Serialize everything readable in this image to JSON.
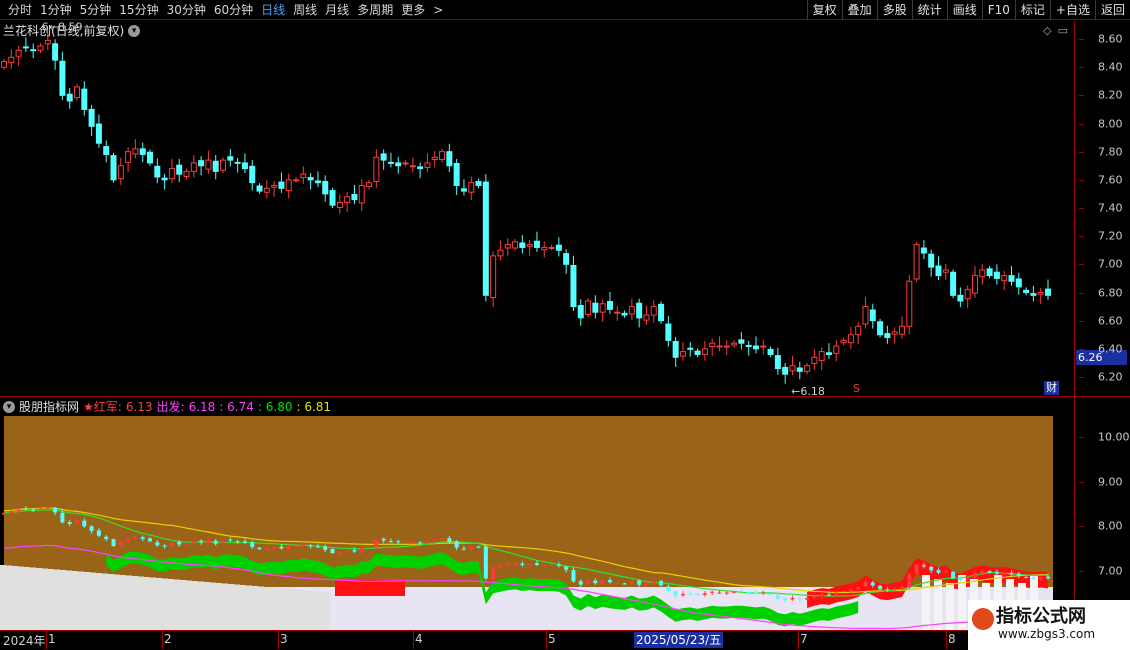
{
  "toolbar": {
    "periods": [
      "分时",
      "1分钟",
      "5分钟",
      "15分钟",
      "30分钟",
      "60分钟",
      "日线",
      "周线",
      "月线",
      "多周期",
      "更多"
    ],
    "active_period": "日线",
    "more_arrow": ">",
    "tools": [
      "复权",
      "叠加",
      "多股",
      "统计",
      "画线",
      "F10",
      "标记",
      "+自选",
      "返回"
    ]
  },
  "main_chart": {
    "title": "兰花科创(日线,前复权)",
    "price_axis": [
      "8.60",
      "8.40",
      "8.20",
      "8.00",
      "7.80",
      "7.60",
      "7.40",
      "7.20",
      "7.00",
      "6.80",
      "6.60",
      "6.40",
      "6.20"
    ],
    "current_price": "6.26",
    "high_marker": "8.59",
    "low_marker": "6.18",
    "s_marker": "S",
    "finance_badge": "财"
  },
  "indicator": {
    "name": "股朋指标网",
    "label_red": "★红军:",
    "value_red": "6.13",
    "label_start": "出发:",
    "values_rest": [
      "6.18",
      ": 6.74",
      ": 6.80",
      ": 6.81"
    ],
    "axis": [
      "10.00",
      "9.00",
      "8.00",
      "7.00"
    ]
  },
  "date_axis": {
    "labels": [
      "2024年",
      "1",
      "2",
      "3",
      "4",
      "5",
      "7",
      "8"
    ],
    "cursor": "2025/05/23/五"
  },
  "watermark": {
    "title": "指标公式网",
    "url": "www.zbgs3.com"
  },
  "colors": {
    "up": "#ff3a3a",
    "down": "#54ffff",
    "brown": "#9a6418",
    "green": "#00d000",
    "yellow": "#e8d000"
  },
  "chart_data": {
    "type": "candlestick",
    "closes": [
      8.44,
      8.47,
      8.52,
      8.54,
      8.52,
      8.55,
      8.59,
      8.45,
      8.2,
      8.16,
      8.26,
      8.1,
      7.98,
      7.86,
      7.78,
      7.6,
      7.7,
      7.8,
      7.82,
      7.78,
      7.72,
      7.62,
      7.6,
      7.68,
      7.64,
      7.66,
      7.72,
      7.7,
      7.74,
      7.66,
      7.74,
      7.74,
      7.72,
      7.68,
      7.58,
      7.52,
      7.54,
      7.56,
      7.54,
      7.6,
      7.6,
      7.64,
      7.6,
      7.58,
      7.5,
      7.42,
      7.44,
      7.48,
      7.46,
      7.56,
      7.58,
      7.76,
      7.74,
      7.72,
      7.7,
      7.72,
      7.7,
      7.68,
      7.72,
      7.76,
      7.8,
      7.7,
      7.56,
      7.52,
      7.58,
      7.56,
      6.78,
      7.06,
      7.1,
      7.14,
      7.16,
      7.12,
      7.14,
      7.12,
      7.12,
      7.12,
      7.1,
      7.0,
      6.7,
      6.62,
      6.74,
      6.66,
      6.72,
      6.68,
      6.66,
      6.64,
      6.7,
      6.62,
      6.64,
      6.7,
      6.6,
      6.46,
      6.34,
      6.38,
      6.4,
      6.36,
      6.4,
      6.44,
      6.42,
      6.42,
      6.44,
      6.44,
      6.42,
      6.4,
      6.42,
      6.36,
      6.26,
      6.22,
      6.28,
      6.24,
      6.28,
      6.34,
      6.38,
      6.36,
      6.42,
      6.46,
      6.5,
      6.56,
      6.7,
      6.6,
      6.5,
      6.48,
      6.52,
      6.56,
      6.88,
      7.14,
      7.08,
      6.98,
      6.92,
      6.96,
      6.78,
      6.74,
      6.82,
      6.92,
      6.96,
      6.92,
      6.9,
      6.92,
      6.88,
      6.84,
      6.8,
      6.78,
      6.8,
      6.78
    ]
  }
}
